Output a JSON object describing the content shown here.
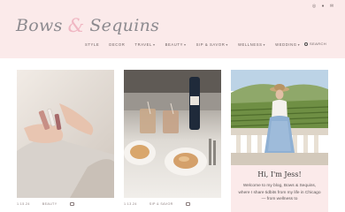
{
  "site": {
    "logo_left": "Bows",
    "logo_amp": "&",
    "logo_right": "Sequins"
  },
  "social": [
    "instagram-icon",
    "pinterest-icon",
    "email-icon"
  ],
  "nav": {
    "items": [
      {
        "label": "STYLE",
        "has_menu": false
      },
      {
        "label": "DECOR",
        "has_menu": false
      },
      {
        "label": "TRAVEL",
        "has_menu": true
      },
      {
        "label": "BEAUTY",
        "has_menu": true
      },
      {
        "label": "SIP & SAVOR",
        "has_menu": true
      },
      {
        "label": "WELLNESS",
        "has_menu": true
      },
      {
        "label": "WEDDING",
        "has_menu": true
      }
    ],
    "search_label": "SEARCH"
  },
  "posts": [
    {
      "date": "1.15.24",
      "category": "BEAUTY",
      "image": "hands-holding-skincare-products"
    },
    {
      "date": "1.13.24",
      "category": "SIP & SAVOR",
      "image": "coffee-and-pastries-on-table"
    }
  ],
  "sidebar": {
    "image": "woman-in-hat-at-vineyard-terrace",
    "title": "Hi, I'm Jess!",
    "text": "Welcome to my blog, Bows & Sequins, where I share tidbits from my life in Chicago — from wellness to"
  },
  "colors": {
    "header_bg": "#fbeaea",
    "logo_text": "#8c8a8f",
    "ampersand": "#f0b7c3"
  }
}
